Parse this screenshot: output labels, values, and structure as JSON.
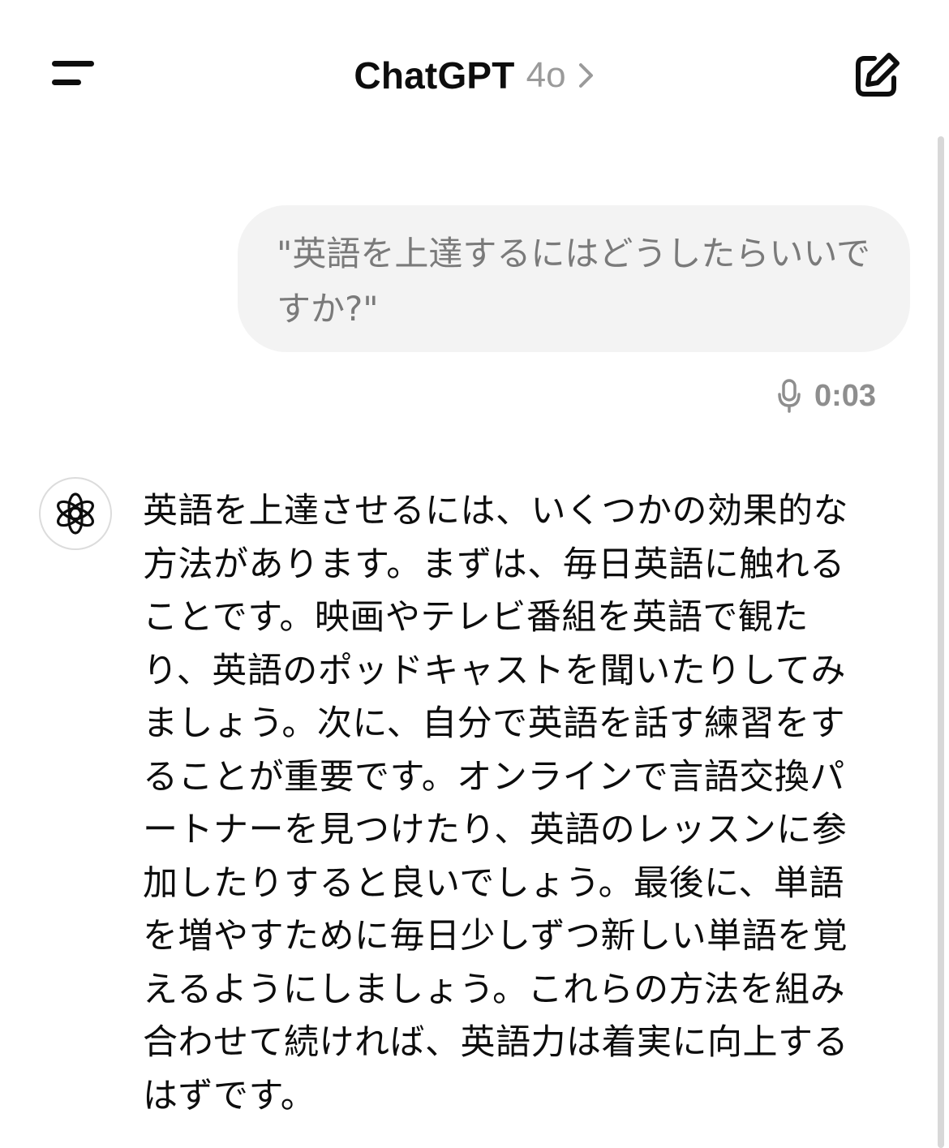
{
  "header": {
    "title": "ChatGPT",
    "model": "4o"
  },
  "conversation": {
    "user_message": "\"英語を上達するにはどうしたらいいですか?\"",
    "voice_duration": "0:03",
    "assistant_message": "英語を上達させるには、いくつかの効果的な方法があります。まずは、毎日英語に触れることです。映画やテレビ番組を英語で観たり、英語のポッドキャストを聞いたりしてみましょう。次に、自分で英語を話す練習をすることが重要です。オンラインで言語交換パートナーを見つけたり、英語のレッスンに参加したりすると良いでしょう。最後に、単語を増やすために毎日少しずつ新しい単語を覚えるようにしましょう。これらの方法を組み合わせて続ければ、英語力は着実に向上するはずです。"
  },
  "icons": {
    "menu": "menu-icon",
    "compose": "new-chat-icon",
    "chevron": "chevron-right-icon",
    "mic": "mic-icon",
    "assistant": "openai-logo-icon"
  },
  "colors": {
    "text": "#0d0d0d",
    "muted": "#8e8e8e",
    "bubble": "#f3f3f3"
  }
}
